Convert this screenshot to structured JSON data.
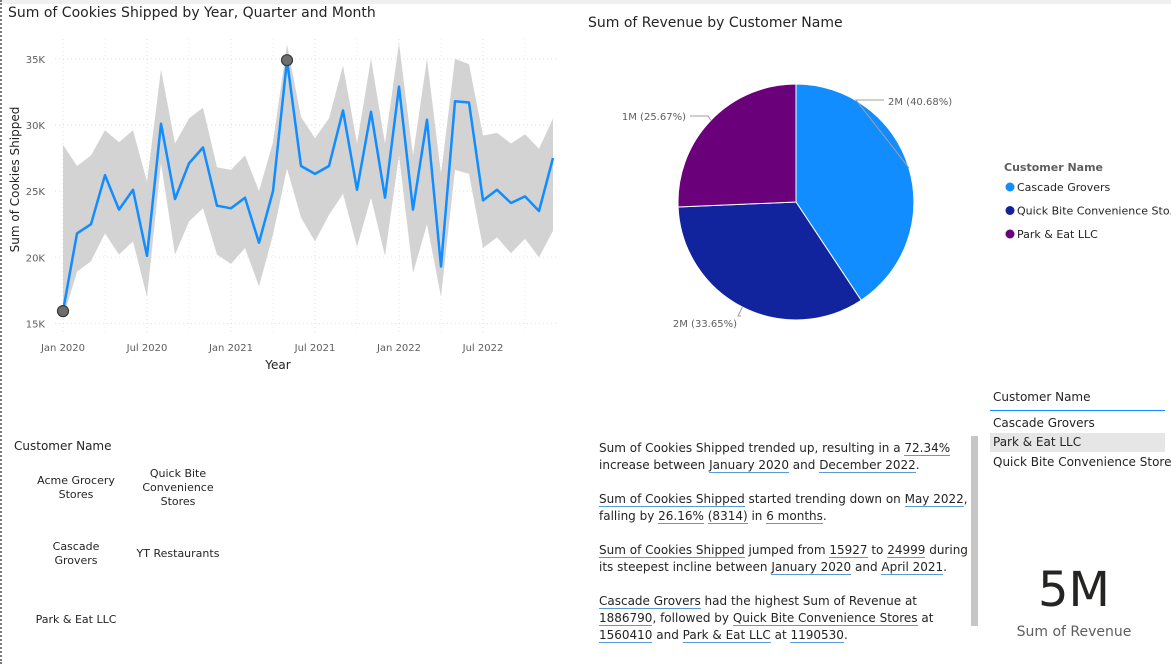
{
  "line_chart": {
    "title": "Sum of Cookies Shipped by Year, Quarter and Month"
  },
  "pie_chart": {
    "title": "Sum of Revenue by Customer Name",
    "legend_title": "Customer Name"
  },
  "chart_data": [
    {
      "type": "line",
      "title": "Sum of Cookies Shipped by Year, Quarter and Month",
      "xlabel": "Year",
      "ylabel": "Sum of Cookies Shipped",
      "x_tick_labels": [
        "Jan 2020",
        "Jul 2020",
        "Jan 2021",
        "Jul 2021",
        "Jan 2022",
        "Jul 2022"
      ],
      "y_tick_labels": [
        "15K",
        "20K",
        "25K",
        "30K",
        "35K"
      ],
      "ylim": [
        14500,
        36500
      ],
      "x": [
        "2020-01",
        "2020-02",
        "2020-03",
        "2020-04",
        "2020-05",
        "2020-06",
        "2020-07",
        "2020-08",
        "2020-09",
        "2020-10",
        "2020-11",
        "2020-12",
        "2021-01",
        "2021-02",
        "2021-03",
        "2021-04",
        "2021-05",
        "2021-06",
        "2021-07",
        "2021-08",
        "2021-09",
        "2021-10",
        "2021-11",
        "2021-12",
        "2022-01",
        "2022-02",
        "2022-03",
        "2022-04",
        "2022-05",
        "2022-06",
        "2022-07",
        "2022-08",
        "2022-09",
        "2022-10",
        "2022-11",
        "2022-12"
      ],
      "series": [
        {
          "values": [
            15927,
            21800,
            22500,
            26200,
            23600,
            25100,
            20100,
            30100,
            24400,
            27100,
            28300,
            23900,
            23700,
            24500,
            21100,
            25000,
            34900,
            26900,
            26300,
            26900,
            31100,
            25100,
            31000,
            24500,
            32900,
            23600,
            30400,
            19300,
            31800,
            31700,
            24300,
            25100,
            24100,
            24600,
            23500,
            27500
          ],
          "color": "#118dff"
        }
      ],
      "forecast_band": {
        "upper": [
          28500,
          26900,
          27700,
          29600,
          28700,
          29600,
          25700,
          34200,
          28600,
          30500,
          31300,
          26800,
          26600,
          27700,
          25000,
          28700,
          36100,
          30600,
          29000,
          30500,
          34500,
          28600,
          35000,
          28600,
          36200,
          27700,
          35000,
          26300,
          35000,
          34600,
          29200,
          29400,
          28600,
          29300,
          28200,
          30500
        ],
        "lower": [
          15400,
          18900,
          19700,
          21800,
          20200,
          21200,
          17000,
          27100,
          20200,
          22700,
          23700,
          20200,
          19500,
          20700,
          17800,
          21700,
          26700,
          23000,
          21200,
          23200,
          24800,
          20800,
          24500,
          20100,
          27700,
          18800,
          22500,
          17000,
          26600,
          26300,
          20700,
          21500,
          20300,
          21400,
          20000,
          22000
        ],
        "color": "#d3d3d3"
      },
      "markers": [
        0,
        16
      ]
    },
    {
      "type": "pie",
      "title": "Sum of Revenue by Customer Name",
      "legend_title": "Customer Name",
      "legend_placement": "right",
      "slices": [
        {
          "name": "Cascade Grovers",
          "value": 40.68,
          "label": "2M (40.68%)",
          "color": "#118dff"
        },
        {
          "name": "Quick Bite Convenience Stores",
          "value": 33.65,
          "label": "2M (33.65%)",
          "color": "#12239e"
        },
        {
          "name": "Park & Eat LLC",
          "value": 25.67,
          "label": "1M (25.67%)",
          "color": "#6b007b"
        }
      ],
      "legend_labels": [
        "Cascade Grovers",
        "Quick Bite Convenience Sto...",
        "Park & Eat LLC"
      ]
    }
  ],
  "tile_slicer": {
    "title": "Customer Name",
    "tiles": [
      {
        "label": "Acme Grocery Stores",
        "selected": false
      },
      {
        "label": "Quick Bite Convenience Stores",
        "selected": true
      },
      {
        "label": "Cascade Grovers",
        "selected": true
      },
      {
        "label": "YT Restaurants",
        "selected": false
      },
      {
        "label": "Park & Eat LLC",
        "selected": true
      }
    ]
  },
  "narrative": {
    "p1": {
      "a": "Sum of Cookies Shipped trended up, resulting in a ",
      "pct": "72.34%",
      "b": " increase between ",
      "from": "January 2020",
      "c": " and ",
      "to": "December 2022",
      "d": "."
    },
    "p2": {
      "measure": "Sum of Cookies Shipped",
      "a": " started trending down on ",
      "date": "May 2022",
      "b": ", falling by ",
      "pct": "26.16%",
      "c": " ",
      "amt": "(8314)",
      "d": " in ",
      "dur": "6 months",
      "e": "."
    },
    "p3": {
      "measure": "Sum of Cookies Shipped",
      "a": " jumped from ",
      "from": "15927",
      "b": " to ",
      "to": "24999",
      "c": " during its steepest incline between ",
      "d1": "January 2020",
      "d": " and ",
      "d2": "April 2021",
      "e": "."
    },
    "p4": {
      "c1": "Cascade Grovers",
      "a": " had the highest Sum of Revenue at ",
      "v1": "1886790",
      "b": ", followed by ",
      "c2": "Quick Bite Convenience Stores",
      "c": " at ",
      "v2": "1560410",
      "d": " and ",
      "c3": "Park & Eat LLC",
      "e": " at ",
      "v3": "1190530",
      "f": "."
    }
  },
  "list_slicer": {
    "title": "Customer Name",
    "items": [
      {
        "label": "Cascade Grovers",
        "selected": false
      },
      {
        "label": "Park & Eat LLC",
        "selected": true
      },
      {
        "label": "Quick Bite Convenience Stores",
        "selected": false
      }
    ]
  },
  "card": {
    "value": "5M",
    "label": "Sum of Revenue"
  }
}
